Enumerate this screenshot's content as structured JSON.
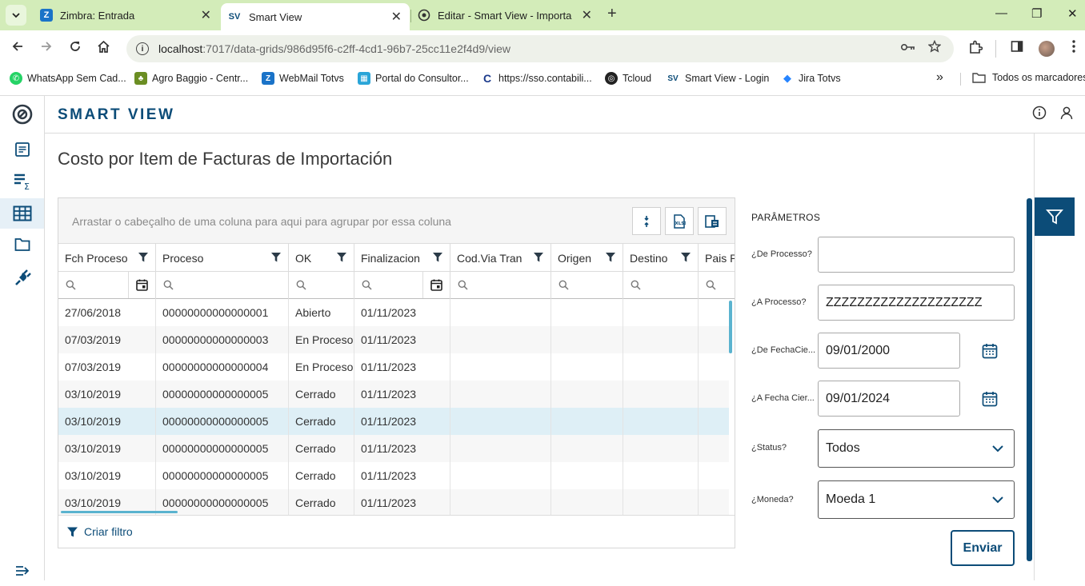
{
  "browser": {
    "tabs": [
      {
        "title": "Zimbra: Entrada",
        "favicon": "Z"
      },
      {
        "title": "Smart View",
        "favicon": "SV"
      },
      {
        "title": "Editar - Smart View - Importaci",
        "favicon": "edit"
      }
    ],
    "url_host": "localhost",
    "url_path": ":7017/data-grids/986d95f6-c2ff-4cd1-96b7-25cc11e2f4d9/view",
    "bookmarks": [
      {
        "label": "WhatsApp Sem Cad...",
        "color": "#25d366",
        "glyph": "✆"
      },
      {
        "label": "Agro Baggio - Centr...",
        "color": "#6b8e23",
        "glyph": "🌿"
      },
      {
        "label": "WebMail Totvs",
        "color": "#1a73c8",
        "glyph": "Z"
      },
      {
        "label": "Portal do Consultor...",
        "color": "#2aa5d8",
        "glyph": "▦"
      },
      {
        "label": "https://sso.contabili...",
        "color": "#1b3a8c",
        "glyph": "C"
      },
      {
        "label": "Tcloud",
        "color": "#222222",
        "glyph": "◎"
      },
      {
        "label": "Smart View - Login",
        "color": "#0c4c78",
        "glyph": "SV"
      },
      {
        "label": "Jira Totvs",
        "color": "#2684ff",
        "glyph": "◆"
      }
    ],
    "more_bookmarks": "»",
    "all_bookmarks": "Todos os marcadores"
  },
  "app": {
    "brand": "SMART VIEW",
    "page_title": "Costo por Item de Facturas de Importación",
    "accent": "#0c4c78"
  },
  "grid": {
    "group_hint": "Arrastar o cabeçalho de uma coluna para aqui para agrupar por essa coluna",
    "columns": [
      "Fch Proceso",
      "Proceso",
      "OK",
      "Finalizacion",
      "Cod.Via Tran",
      "Origen",
      "Destino",
      "Pais P"
    ],
    "rows": [
      [
        "27/06/2018",
        "00000000000000001",
        "Abierto",
        "01/11/2023",
        "",
        "",
        "",
        ""
      ],
      [
        "07/03/2019",
        "00000000000000003",
        "En Proceso",
        "01/11/2023",
        "",
        "",
        "",
        ""
      ],
      [
        "07/03/2019",
        "00000000000000004",
        "En Proceso",
        "01/11/2023",
        "",
        "",
        "",
        ""
      ],
      [
        "03/10/2019",
        "00000000000000005",
        "Cerrado",
        "01/11/2023",
        "",
        "",
        "",
        ""
      ],
      [
        "03/10/2019",
        "00000000000000005",
        "Cerrado",
        "01/11/2023",
        "",
        "",
        "",
        ""
      ],
      [
        "03/10/2019",
        "00000000000000005",
        "Cerrado",
        "01/11/2023",
        "",
        "",
        "",
        ""
      ],
      [
        "03/10/2019",
        "00000000000000005",
        "Cerrado",
        "01/11/2023",
        "",
        "",
        "",
        ""
      ],
      [
        "03/10/2019",
        "00000000000000005",
        "Cerrado",
        "01/11/2023",
        "",
        "",
        "",
        ""
      ]
    ],
    "selected_row": 4,
    "create_filter": "Criar filtro"
  },
  "params": {
    "title": "PARÂMETROS",
    "de_processo": {
      "label": "¿De Processo?",
      "value": ""
    },
    "a_processo": {
      "label": "¿A Processo?",
      "value": "ZZZZZZZZZZZZZZZZZZZZ"
    },
    "de_fecha": {
      "label": "¿De FechaCie...",
      "value": "09/01/2000"
    },
    "a_fecha": {
      "label": "¿A Fecha Cier...",
      "value": "09/01/2024"
    },
    "status": {
      "label": "¿Status?",
      "value": "Todos"
    },
    "moneda": {
      "label": "¿Moneda?",
      "value": "Moeda 1"
    },
    "submit": "Enviar"
  }
}
